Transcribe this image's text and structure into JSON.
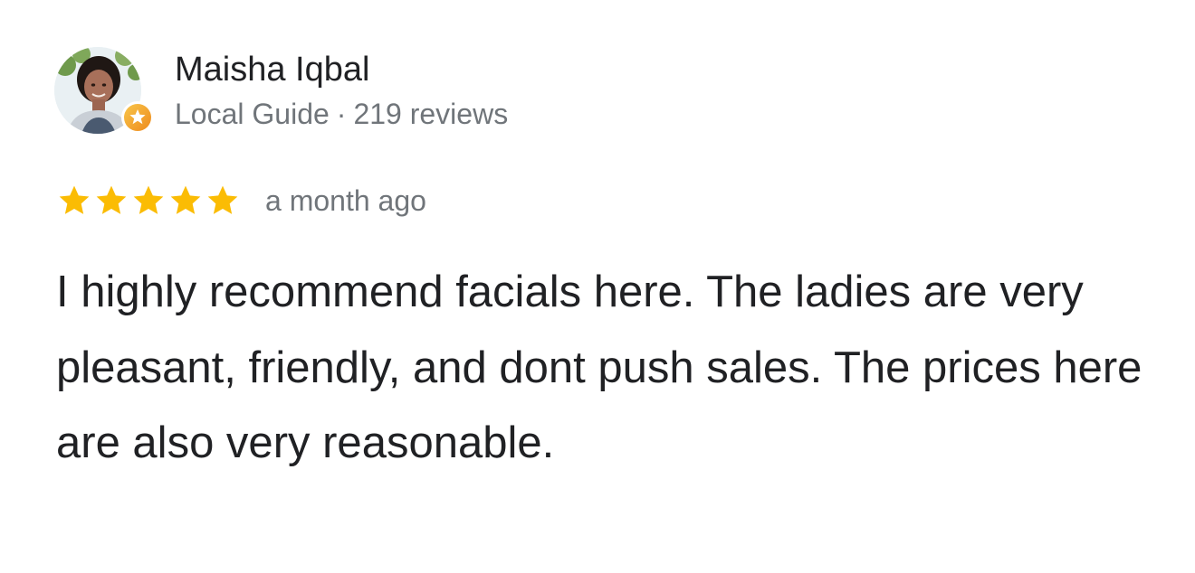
{
  "reviewer": {
    "name": "Maisha Iqbal",
    "level": "Local Guide",
    "separator": "·",
    "reviews_count": "219 reviews",
    "avatar_icon": "profile-photo",
    "badge_icon": "local-guide-star-badge"
  },
  "rating": {
    "stars": 5,
    "max_stars": 5,
    "star_color": "#fbbc04",
    "time": "a month ago"
  },
  "review": {
    "text": "I highly recommend facials here. The ladies are very pleasant, friendly, and dont push sales. The prices here are also very reasonable."
  },
  "colors": {
    "primary_text": "#202124",
    "secondary_text": "#70757a",
    "badge_orange": "#f29900"
  }
}
